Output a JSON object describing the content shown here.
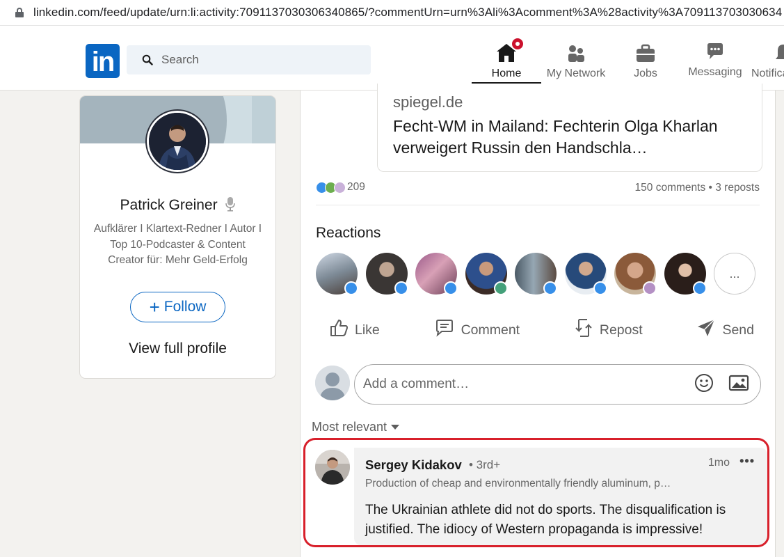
{
  "browser": {
    "url": "linkedin.com/feed/update/urn:li:activity:7091137030306340865/?commentUrn=urn%3Ali%3Acomment%3A%28activity%3A709113703030634"
  },
  "nav": {
    "logo": "in",
    "search_placeholder": "Search",
    "items": [
      {
        "label": "Home",
        "icon": "home-icon",
        "active": true
      },
      {
        "label": "My Network",
        "icon": "network-icon",
        "active": false
      },
      {
        "label": "Jobs",
        "icon": "briefcase-icon",
        "active": false
      },
      {
        "label": "Messaging",
        "icon": "messaging-icon",
        "active": false
      },
      {
        "label": "Notifications",
        "icon": "bell-icon",
        "active": false
      }
    ],
    "accent": "#0a66c2"
  },
  "profile": {
    "name": "Patrick Greiner",
    "headline": "Aufklärer I Klartext-Redner I Autor I Top 10-Podcaster & Content Creator für: Mehr Geld-Erfolg",
    "follow_label": "Follow",
    "view_profile_label": "View full profile"
  },
  "post": {
    "link_domain": "spiegel.de",
    "link_title": "Fecht-WM in Mailand: Fechterin Olga Kharlan verweigert Russin den Handschla…",
    "reaction_count": "209",
    "comment_stats": "150 comments • 3 reposts",
    "reactions_title": "Reactions",
    "more_reactors": "...",
    "actions": [
      {
        "label": "Like",
        "icon": "like-icon"
      },
      {
        "label": "Comment",
        "icon": "comment-icon"
      },
      {
        "label": "Repost",
        "icon": "repost-icon"
      },
      {
        "label": "Send",
        "icon": "send-icon"
      }
    ],
    "comment_placeholder": "Add a comment…",
    "sort_label": "Most relevant"
  },
  "comment": {
    "author": "Sergey Kidakov",
    "degree": "• 3rd+",
    "time": "1mo",
    "more": "•••",
    "subtitle": "Production of cheap and environmentally friendly aluminum, p…",
    "text": "The Ukrainian athlete did not do sports. The disqualification is justified. The idiocy of Western propaganda is impressive!"
  },
  "highlight_color": "#d8202b"
}
